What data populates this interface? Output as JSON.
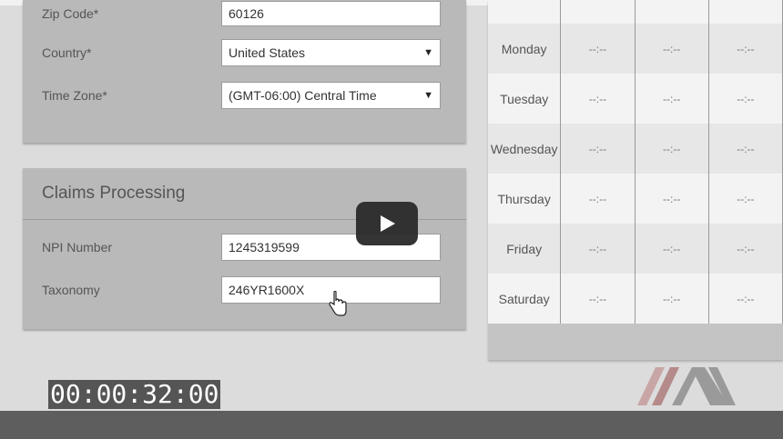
{
  "address": {
    "zip": {
      "label": "Zip Code*",
      "value": "60126"
    },
    "country": {
      "label": "Country*",
      "value": "United States"
    },
    "timezone": {
      "label": "Time Zone*",
      "value": "(GMT-06:00) Central Time"
    }
  },
  "claims": {
    "title": "Claims Processing",
    "npi": {
      "label": "NPI Number",
      "value": "1245319599"
    },
    "taxonomy": {
      "label": "Taxonomy",
      "value": "246YR1600X"
    }
  },
  "schedule": {
    "rows": [
      {
        "day": "Monday",
        "cells": [
          "--:--",
          "--:--",
          "--:--"
        ]
      },
      {
        "day": "Tuesday",
        "cells": [
          "--:--",
          "--:--",
          "--:--"
        ]
      },
      {
        "day": "Wednesday",
        "cells": [
          "--:--",
          "--:--",
          "--:--"
        ]
      },
      {
        "day": "Thursday",
        "cells": [
          "--:--",
          "--:--",
          "--:--"
        ]
      },
      {
        "day": "Friday",
        "cells": [
          "--:--",
          "--:--",
          "--:--"
        ]
      },
      {
        "day": "Saturday",
        "cells": [
          "--:--",
          "--:--",
          "--:--"
        ]
      }
    ]
  },
  "video": {
    "timestamp": "00:00:32:00",
    "play_icon": "play-icon"
  },
  "icons": {
    "dropdown": "chevron-down-icon",
    "cursor": "hand-pointer-icon",
    "logo": "im-logo"
  },
  "colors": {
    "logo_left": "#c9a6a6",
    "logo_right": "#9a9a9a"
  }
}
